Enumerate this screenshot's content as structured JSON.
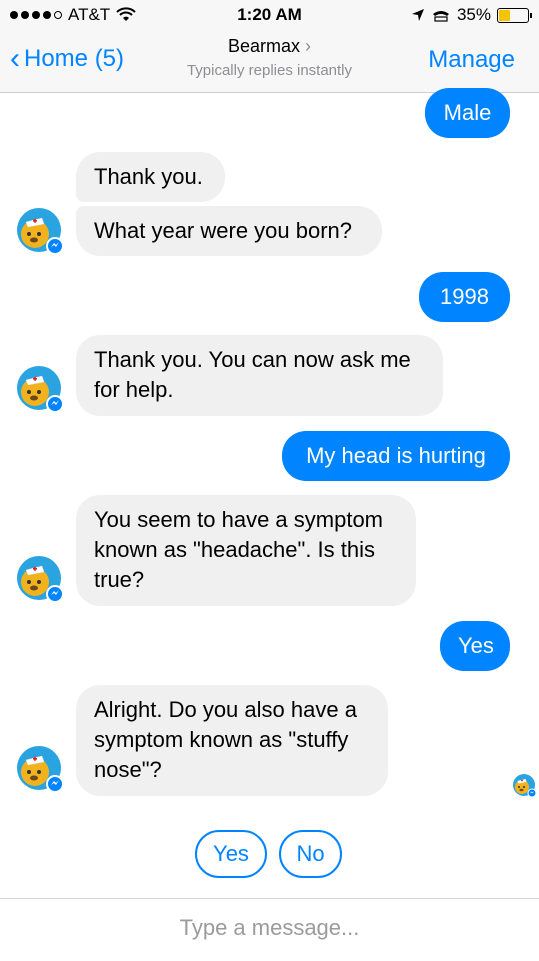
{
  "status_bar": {
    "carrier": "AT&T",
    "time": "1:20 AM",
    "battery": "35%"
  },
  "nav": {
    "back_label": "Home (5)",
    "title": "Bearmax",
    "title_chevron": "›",
    "subtitle": "Typically replies instantly",
    "manage_label": "Manage"
  },
  "messages": [
    {
      "from": "user",
      "text": "Male"
    },
    {
      "from": "bot",
      "text": "Thank you."
    },
    {
      "from": "bot",
      "text": "What year were you born?"
    },
    {
      "from": "user",
      "text": "1998"
    },
    {
      "from": "bot",
      "text": "Thank you. You can now ask me for help."
    },
    {
      "from": "user",
      "text": "My head is hurting"
    },
    {
      "from": "bot",
      "text": "You seem to have a symptom known as \"headache\". Is this true?"
    },
    {
      "from": "user",
      "text": "Yes"
    },
    {
      "from": "bot",
      "text": "Alright. Do you also have a symptom known as \"stuffy nose\"?"
    }
  ],
  "quick_replies": [
    "Yes",
    "No"
  ],
  "composer": {
    "placeholder": "Type a message..."
  },
  "colors": {
    "accent": "#0084ff",
    "incoming_bubble": "#f1f0f0",
    "battery_fill": "#f5c400"
  }
}
